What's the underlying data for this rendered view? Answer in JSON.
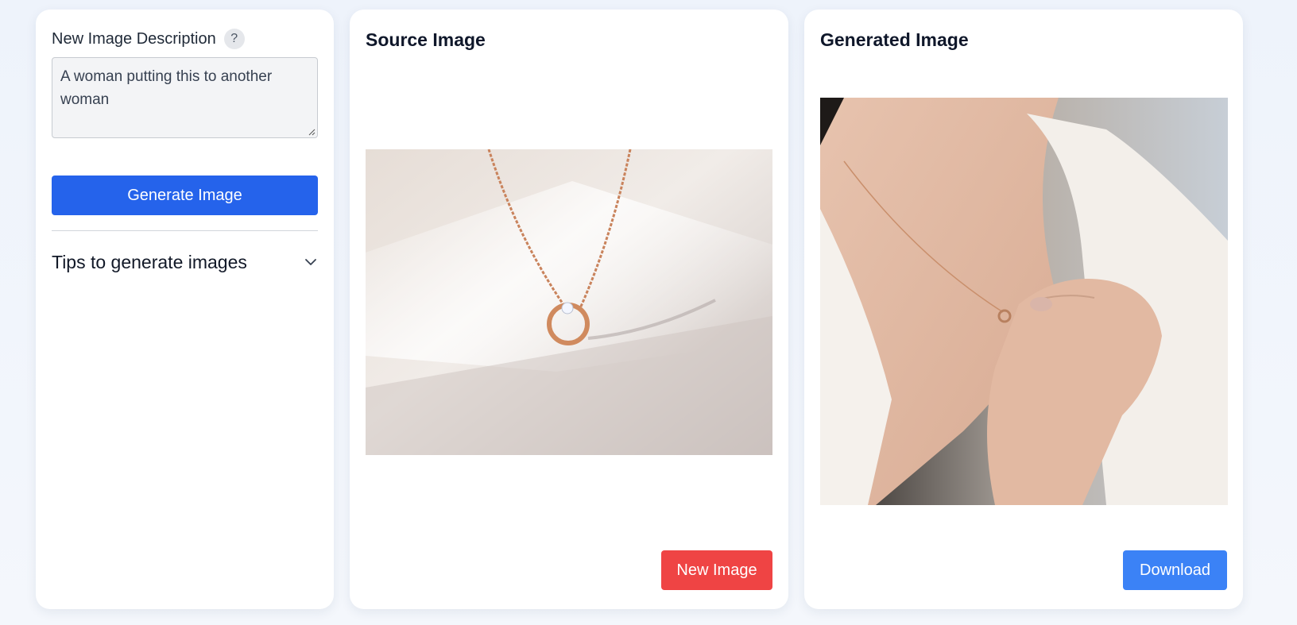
{
  "left_panel": {
    "description_label": "New Image Description",
    "help_badge": "?",
    "description_value": "A woman putting this to another woman",
    "generate_button": "Generate Image",
    "tips_title": "Tips to generate images"
  },
  "source_panel": {
    "title": "Source Image",
    "new_image_button": "New Image"
  },
  "generated_panel": {
    "title": "Generated Image",
    "download_button": "Download"
  },
  "colors": {
    "primary_blue": "#2563eb",
    "download_blue": "#3b82f6",
    "danger_red": "#ef4444"
  },
  "icons": {
    "tips_toggle": "chevron-down-icon",
    "help": "question-mark-icon"
  }
}
